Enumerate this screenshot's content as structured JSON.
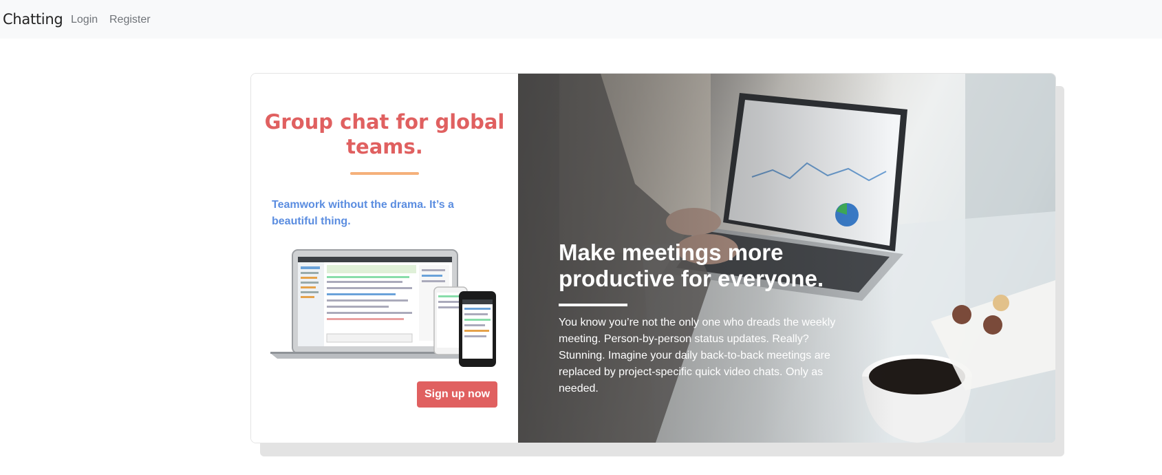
{
  "navbar": {
    "brand": "Chatting",
    "links": [
      "Login",
      "Register"
    ]
  },
  "promo": {
    "headline": "Group chat for global teams.",
    "tagline": "Teamwork without the drama. It’s a beautiful thing.",
    "cta_label": "Sign up now",
    "colors": {
      "headline": "#e06060",
      "accent_line": "#f5b07a",
      "tagline": "#5b8de0",
      "cta": "#e06060"
    }
  },
  "hero": {
    "title": "Make meetings more productive for everyone.",
    "body": "You know you’re not the only one who dreads the weekly meeting. Person-by-person status updates. Really? Stunning. Imagine your daily back-to-back meetings are replaced by project-specific quick video chats. Only as needed."
  }
}
